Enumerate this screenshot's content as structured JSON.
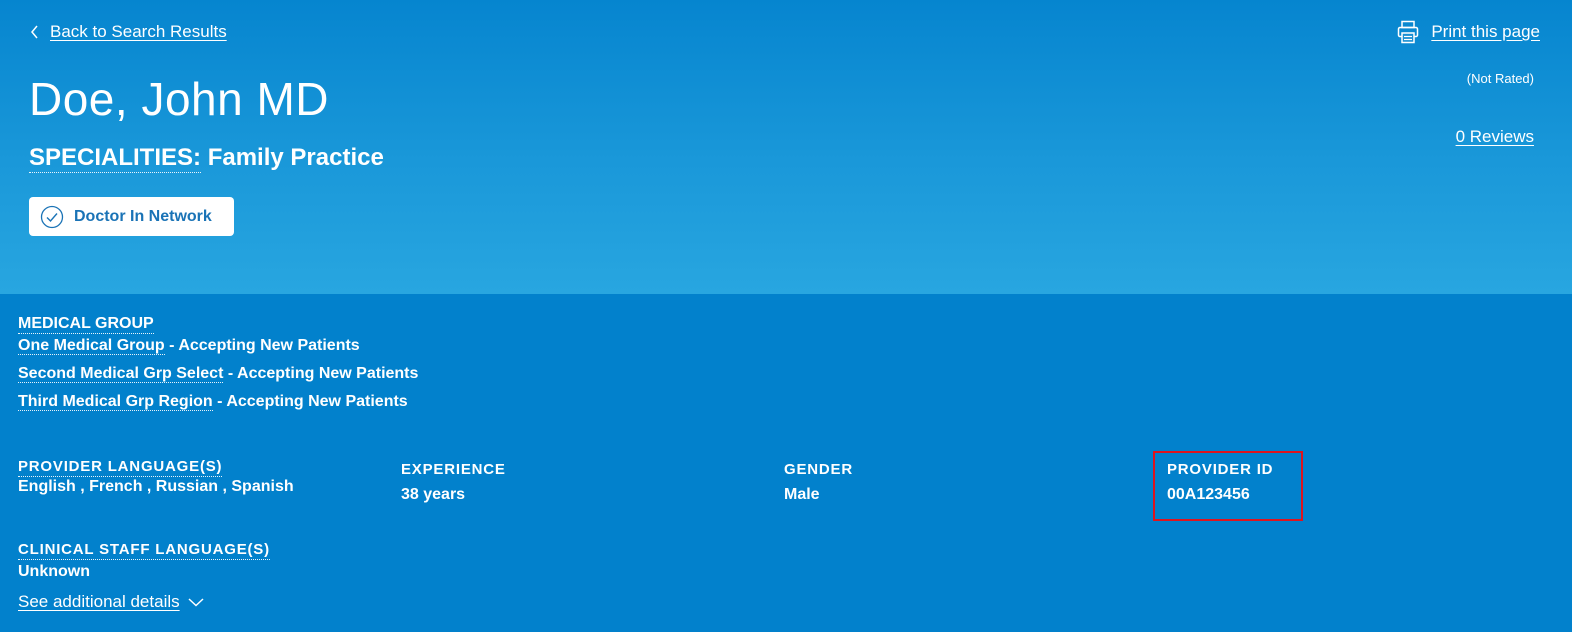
{
  "nav": {
    "back_label": "Back to Search Results",
    "print_label": "Print this page"
  },
  "header": {
    "name": "Doe, John MD",
    "specialities_label": "SPECIALITIES:",
    "speciality": "Family Practice",
    "network_badge": "Doctor In Network",
    "rating": "(Not Rated)",
    "reviews": "0 Reviews"
  },
  "medical_group": {
    "title": "MEDICAL GROUP",
    "groups": [
      {
        "name": "One Medical Group",
        "status": " - Accepting New Patients"
      },
      {
        "name": "Second Medical Grp Select",
        "status": " - Accepting New Patients"
      },
      {
        "name": "Third Medical Grp Region",
        "status": " - Accepting New Patients"
      }
    ]
  },
  "info": {
    "provider_languages_label": "PROVIDER LANGUAGE(S)",
    "provider_languages": "English , French , Russian , Spanish",
    "experience_label": "EXPERIENCE",
    "experience": "38 years",
    "gender_label": "GENDER",
    "gender": "Male",
    "provider_id_label": "PROVIDER ID",
    "provider_id": "00A123456",
    "clinical_staff_label": "CLINICAL STAFF LANGUAGE(S)",
    "clinical_staff": "Unknown"
  },
  "more_details": "See additional details",
  "colors": {
    "hero_top": "#0685cf",
    "hero_bottom": "#28a6e0",
    "details_bg": "#0281cc",
    "badge_text": "#1a73b6",
    "highlight": "#e0141e"
  }
}
